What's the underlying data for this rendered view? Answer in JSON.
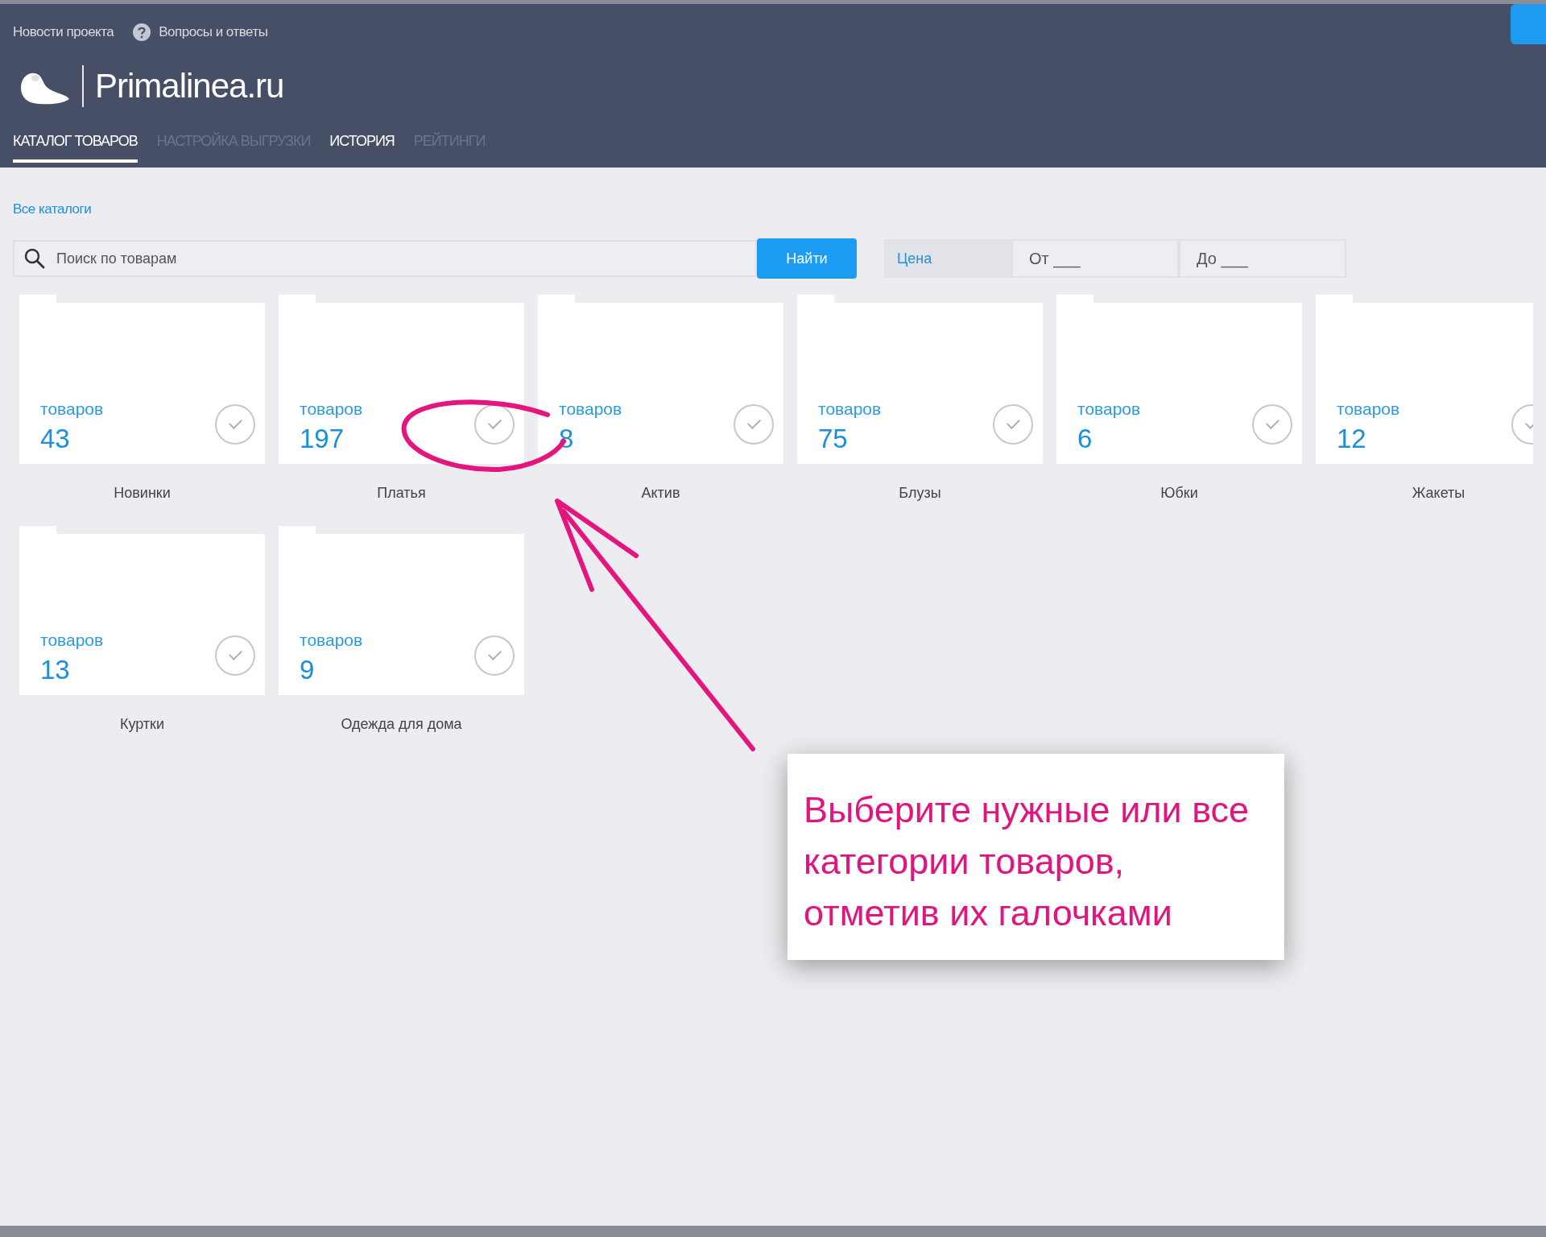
{
  "header": {
    "links": [
      {
        "label": "Новости проекта",
        "icon": false
      },
      {
        "label": "Вопросы и ответы",
        "icon": true
      }
    ],
    "logo_text": "Primalinea.ru",
    "tabs": [
      {
        "label": "КАТАЛОГ ТОВАРОВ",
        "selected": true,
        "disabled": false
      },
      {
        "label": "НАСТРОЙКА ВЫГРУЗКИ",
        "selected": false,
        "disabled": true
      },
      {
        "label": "ИСТОРИЯ",
        "selected": false,
        "disabled": false
      },
      {
        "label": "РЕЙТИНГИ",
        "selected": false,
        "disabled": true
      }
    ]
  },
  "breadcrumb": "Все каталоги",
  "search": {
    "placeholder": "Поиск по товарам",
    "button": "Найти"
  },
  "price": {
    "label": "Цена",
    "from_placeholder": "От ___",
    "to_placeholder": "До ___"
  },
  "categories": [
    {
      "count_label": "товаров",
      "count": "43",
      "name": "Новинки",
      "checked": false
    },
    {
      "count_label": "товаров",
      "count": "197",
      "name": "Платья",
      "checked": false
    },
    {
      "count_label": "товаров",
      "count": "8",
      "name": "Актив",
      "checked": false
    },
    {
      "count_label": "товаров",
      "count": "75",
      "name": "Блузы",
      "checked": false
    },
    {
      "count_label": "товаров",
      "count": "6",
      "name": "Юбки",
      "checked": false
    },
    {
      "count_label": "товаров",
      "count": "12",
      "name": "Жакеты",
      "checked": false
    },
    {
      "count_label": "товаров",
      "count": "13",
      "name": "Куртки",
      "checked": false
    },
    {
      "count_label": "товаров",
      "count": "9",
      "name": "Одежда для дома",
      "checked": false
    }
  ],
  "annotation": {
    "callout": "Выберите нужные или все категории товаров, отметив их галочками"
  }
}
